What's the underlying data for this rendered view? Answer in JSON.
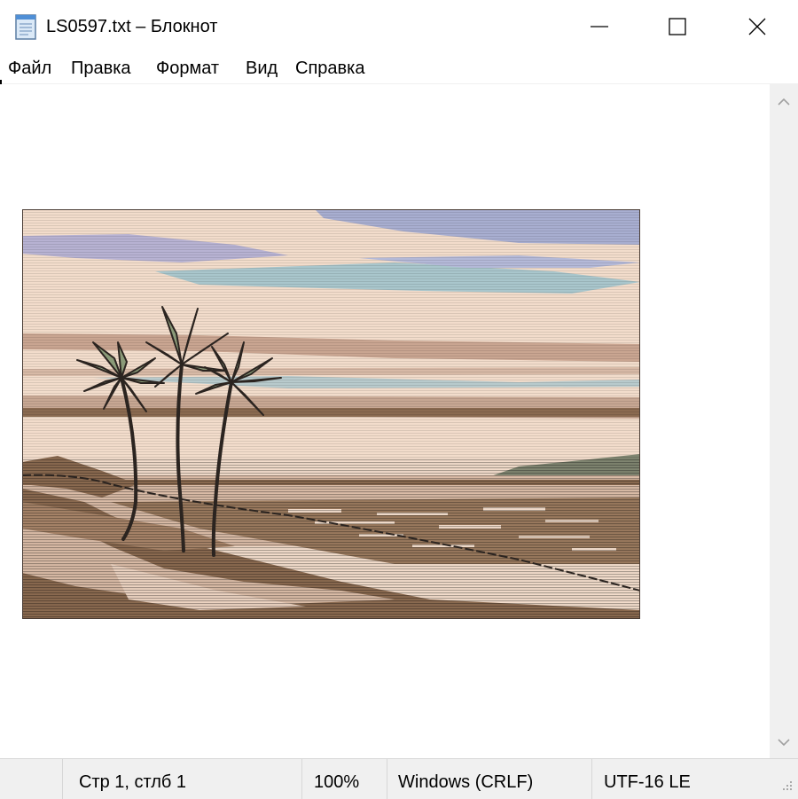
{
  "window": {
    "title": "LS0597.txt – Блокнот",
    "app_icon": "notepad-icon",
    "controls": [
      "minimize-icon",
      "maximize-icon",
      "close-icon"
    ]
  },
  "menu": {
    "items": [
      {
        "label": "Файл"
      },
      {
        "label": "Правка"
      },
      {
        "label": "Формат"
      },
      {
        "label": "Вид"
      },
      {
        "label": "Справка"
      }
    ]
  },
  "editor": {
    "content_description_icon": "ascii-art-palm-beach",
    "colors": {
      "sky": "#f2dccb",
      "cloud_blue": "#a8aed0",
      "cloud_teal": "#a9c6cc",
      "palm_leaf": "#8a9a78",
      "sand_dark": "#8a6a50",
      "hill": "#7f8570",
      "line": "#2b2420"
    }
  },
  "scrollbar": {
    "up_icon": "chevron-up-icon",
    "down_icon": "chevron-down-icon"
  },
  "status": {
    "position": "Стр 1, стлб 1",
    "zoom": "100%",
    "line_endings": "Windows (CRLF)",
    "encoding": "UTF-16 LE"
  }
}
